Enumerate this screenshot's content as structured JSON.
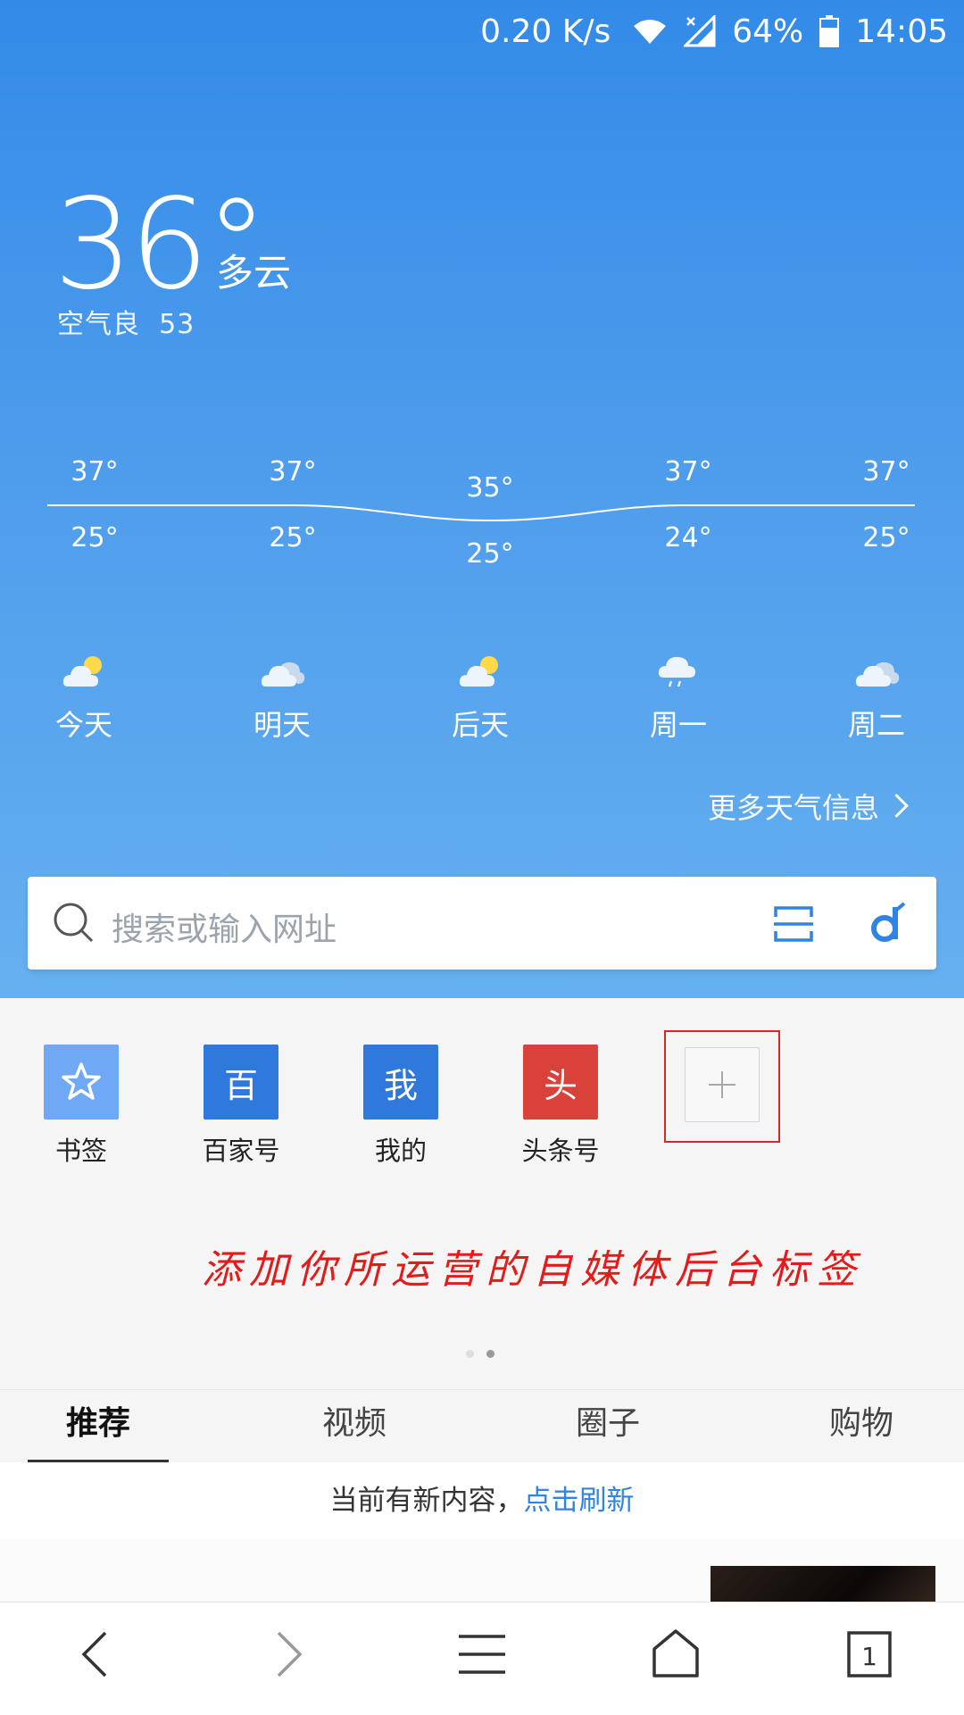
{
  "status_bar": {
    "net_speed": "0.20 K/s",
    "battery": "64%",
    "time": "14:05"
  },
  "weather": {
    "temperature": "36°",
    "condition": "多云",
    "air_quality": "空气良",
    "aqi": "53",
    "forecast_highs": [
      "37°",
      "37°",
      "35°",
      "37°",
      "37°"
    ],
    "forecast_lows": [
      "25°",
      "25°",
      "25°",
      "24°",
      "25°"
    ],
    "days": [
      {
        "label": "今天",
        "icon": "partly-sunny-icon"
      },
      {
        "label": "明天",
        "icon": "cloudy-icon"
      },
      {
        "label": "后天",
        "icon": "partly-sunny-icon"
      },
      {
        "label": "周一",
        "icon": "rain-icon"
      },
      {
        "label": "周二",
        "icon": "cloudy-icon"
      }
    ],
    "more_link": "更多天气信息"
  },
  "search": {
    "placeholder": "搜索或输入网址"
  },
  "shortcuts": [
    {
      "label": "书签",
      "glyph": "☆",
      "color": "#6fa8f5"
    },
    {
      "label": "百家号",
      "glyph": "百",
      "color": "#2f78dc"
    },
    {
      "label": "我的",
      "glyph": "我",
      "color": "#2f78dc"
    },
    {
      "label": "头条号",
      "glyph": "头",
      "color": "#d8423a"
    }
  ],
  "annotation": "添加你所运营的自媒体后台标签",
  "tabs": [
    "推荐",
    "视频",
    "圈子",
    "购物"
  ],
  "notice": {
    "text": "当前有新内容，",
    "link": "点击刷新"
  },
  "tab_count": "1"
}
